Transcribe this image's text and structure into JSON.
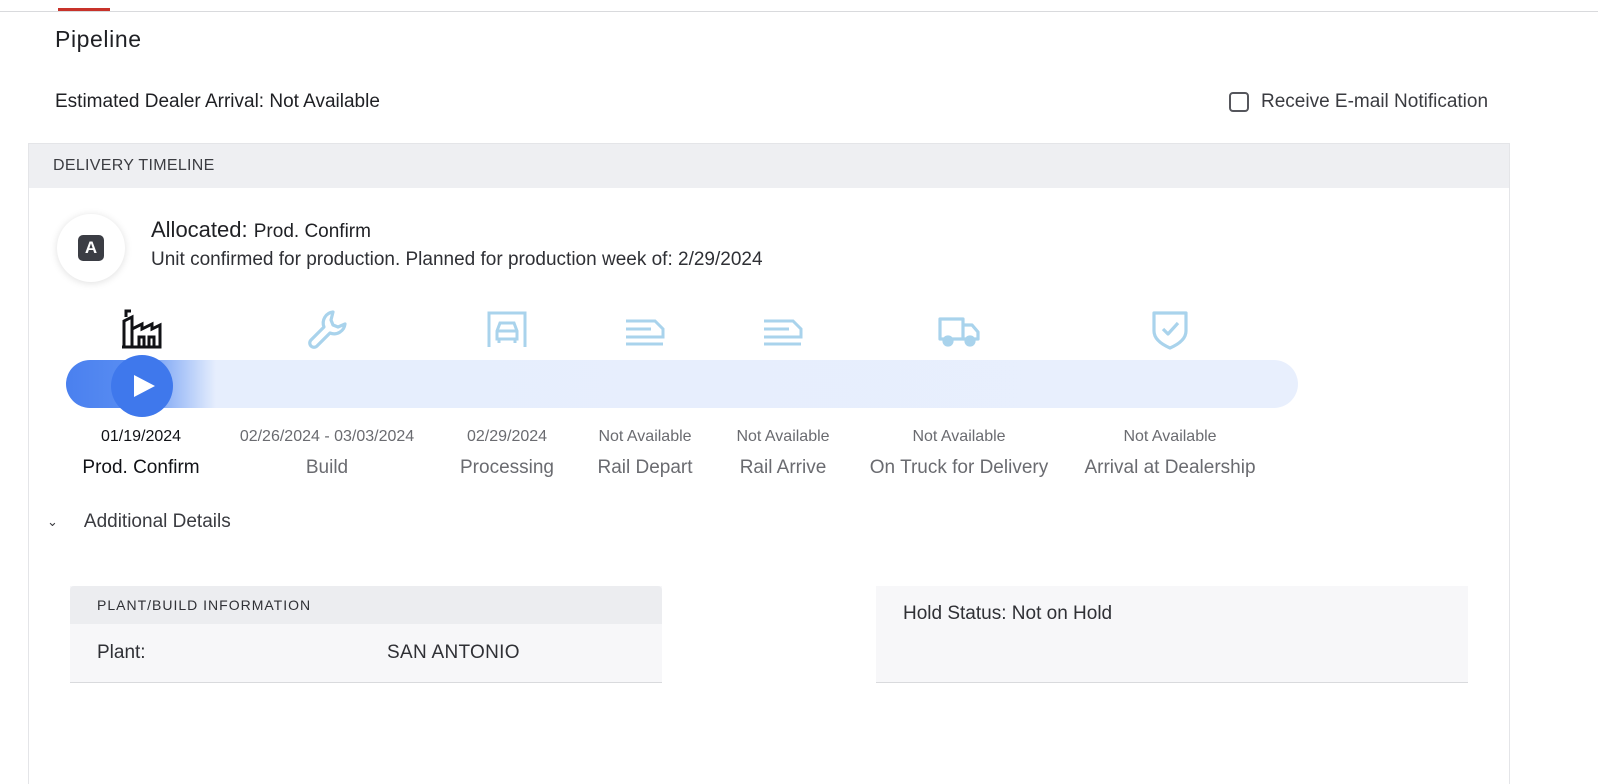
{
  "page": {
    "title": "Pipeline",
    "estimated_arrival": "Estimated Dealer Arrival: Not Available",
    "notification_label": "Receive E-mail Notification"
  },
  "timeline": {
    "header": "DELIVERY TIMELINE",
    "status_badge_letter": "A",
    "status_title": "Allocated:",
    "status_subtitle": "Prod. Confirm",
    "status_description": "Unit confirmed for production. Planned for production week of: 2/29/2024",
    "progress_fraction": 0.06,
    "steps": [
      {
        "date": "01/19/2024",
        "label": "Prod. Confirm",
        "icon": "factory-icon",
        "active": true
      },
      {
        "date": "02/26/2024 - 03/03/2024",
        "label": "Build",
        "icon": "wrench-icon",
        "active": false
      },
      {
        "date": "02/29/2024",
        "label": "Processing",
        "icon": "car-garage-icon",
        "active": false
      },
      {
        "date": "Not Available",
        "label": "Rail Depart",
        "icon": "train-icon",
        "active": false
      },
      {
        "date": "Not Available",
        "label": "Rail Arrive",
        "icon": "train-icon",
        "active": false
      },
      {
        "date": "Not Available",
        "label": "On Truck for Delivery",
        "icon": "truck-icon",
        "active": false
      },
      {
        "date": "Not Available",
        "label": "Arrival at Dealership",
        "icon": "shield-check-icon",
        "active": false
      }
    ]
  },
  "details": {
    "toggle_label": "Additional Details",
    "plant_card": {
      "header": "PLANT/BUILD INFORMATION",
      "plant_label": "Plant:",
      "plant_value": "SAN ANTONIO"
    },
    "hold_status": "Hold Status: Not on Hold"
  },
  "colors": {
    "accent": "#c8322a",
    "progress_blue": "#3f78ec",
    "inactive_icon": "#a9d3ec",
    "track_light": "#e8effd"
  }
}
